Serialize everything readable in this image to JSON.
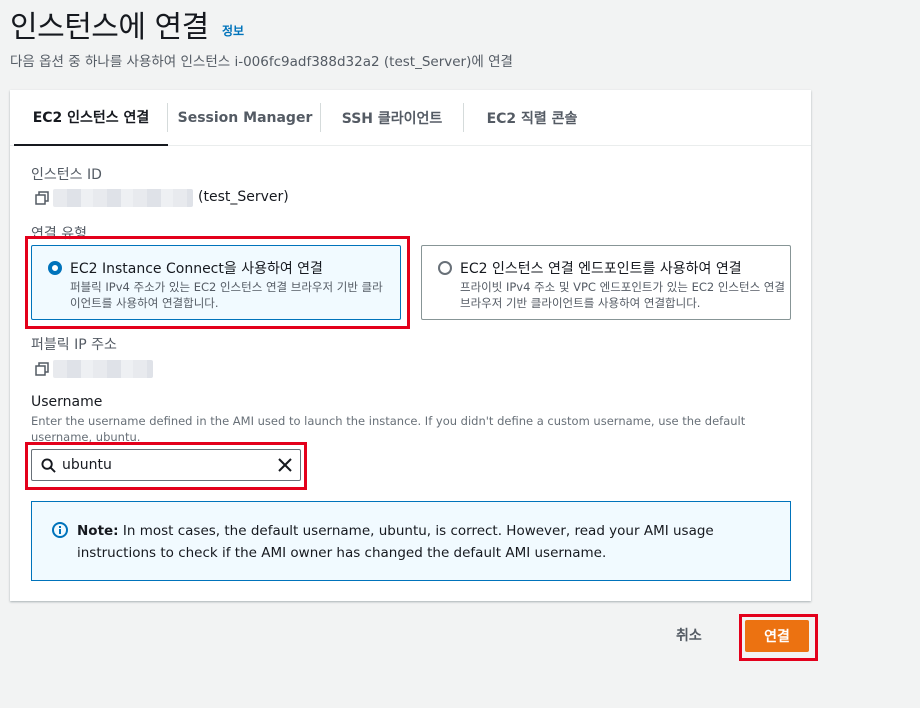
{
  "header": {
    "title": "인스턴스에 연결",
    "info_link": "정보",
    "subtitle": "다음 옵션 중 하나를 사용하여 인스턴스 i-006fc9adf388d32a2 (test_Server)에 연결"
  },
  "tabs": [
    {
      "label": "EC2 인스턴스 연결",
      "active": true
    },
    {
      "label": "Session Manager",
      "active": false
    },
    {
      "label": "SSH 클라이언트",
      "active": false
    },
    {
      "label": "EC2 직렬 콘솔",
      "active": false
    }
  ],
  "instance": {
    "label": "인스턴스 ID",
    "name_suffix": "(test_Server)",
    "icon": "copy-icon"
  },
  "connection_type": {
    "label": "연결 유형",
    "options": [
      {
        "title": "EC2 Instance Connect을 사용하여 연결",
        "description": "퍼블릭 IPv4 주소가 있는 EC2 인스턴스 연결 브라우저 기반 클라이언트를 사용하여 연결합니다.",
        "selected": true
      },
      {
        "title": "EC2 인스턴스 연결 엔드포인트를 사용하여 연결",
        "description": "프라이빗 IPv4 주소 및 VPC 엔드포인트가 있는 EC2 인스턴스 연결 브라우저 기반 클라이언트를 사용하여 연결합니다.",
        "selected": false
      }
    ]
  },
  "public_ip": {
    "label": "퍼블릭 IP 주소",
    "icon": "copy-icon"
  },
  "username": {
    "label": "Username",
    "description": "Enter the username defined in the AMI used to launch the instance. If you didn't define a custom username, use the default username, ubuntu.",
    "value": "ubuntu",
    "search_icon": "search-icon",
    "clear_icon": "close-icon"
  },
  "alert": {
    "icon": "info-icon",
    "strong": "Note:",
    "text": " In most cases, the default username, ubuntu, is correct. However, read your AMI usage instructions to check if the AMI owner has changed the default AMI username."
  },
  "footer": {
    "cancel_label": "취소",
    "connect_label": "연결"
  },
  "colors": {
    "primary": "#ec7211",
    "link": "#0073bb",
    "highlight": "#e3001b"
  }
}
